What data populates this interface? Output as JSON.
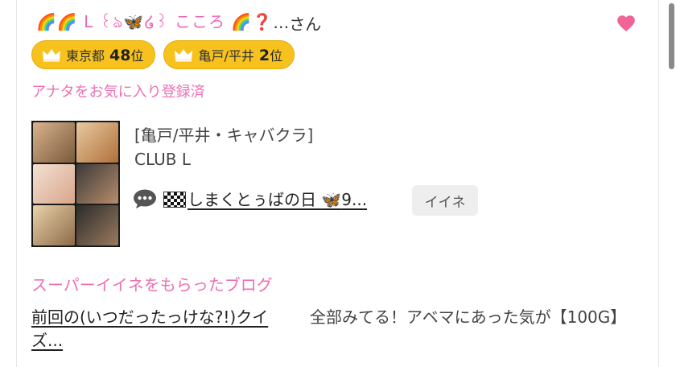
{
  "profile": {
    "name_decorated": "🌈🌈 L ꒰ঌ🦋໒꒱ こころ 🌈❓",
    "name_ellipsis": "…",
    "name_suffix": "さん",
    "favorited": true,
    "heart_color": "#f06596"
  },
  "badges": [
    {
      "area": "東京都",
      "rank": "48",
      "suffix": "位"
    },
    {
      "area": "亀戸/平井",
      "rank": "2",
      "suffix": "位"
    }
  ],
  "favorite_label": "アナタをお気に入り登録済",
  "shop": {
    "category": "[亀戸/平井・キャバクラ]",
    "name": "CLUB L"
  },
  "message": {
    "flag_icon": "checkered-flag-icon",
    "text": "しまくとぅばの日 ",
    "butterfly": "🦋",
    "tail": "9...",
    "iine_label": "イイネ"
  },
  "super_iine_label": "スーパーイイネをもらったブログ",
  "blogs": {
    "left_title": "前回の(いつだったっけな?!)クイズ...",
    "right_title": "全部みてる！アベマにあった気が【100G】"
  },
  "colors": {
    "accent_pink": "#ee6fb3",
    "badge_gold": "#f7c21e"
  }
}
